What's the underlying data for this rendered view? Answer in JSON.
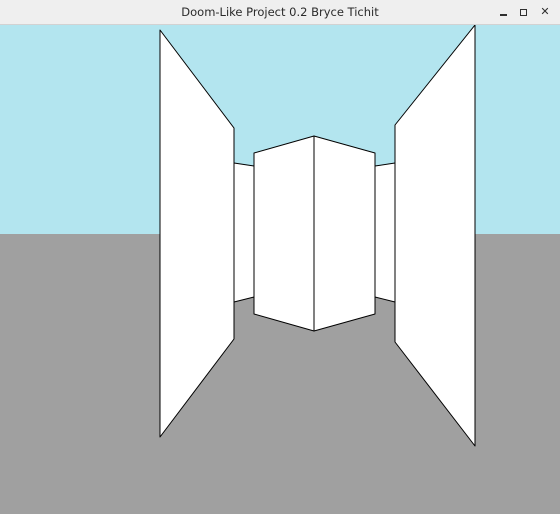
{
  "window": {
    "title": "Doom-Like Project 0.2 Bryce Tichit",
    "titlebar_bg": "#efefef",
    "buttons": {
      "minimize_icon": "minimize-icon",
      "maximize_icon": "maximize-icon",
      "close_icon": "close-icon",
      "close_glyph": "✕"
    }
  },
  "scene": {
    "sky_color": "#b3e5ef",
    "floor_color": "#a0a0a0",
    "wall_color": "#ffffff",
    "wall_edge_color": "#000000"
  }
}
